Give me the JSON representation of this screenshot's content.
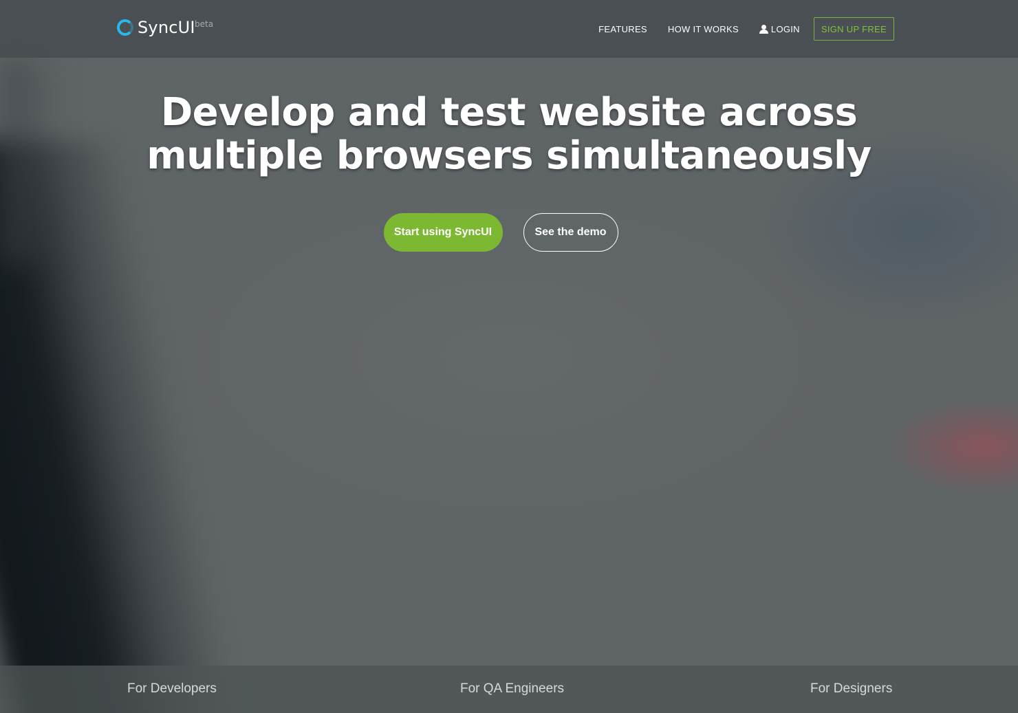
{
  "brand": {
    "name": "SyncUI",
    "badge": "beta",
    "logo_icon": "ring-logo-icon",
    "accent_color": "#29b6e8"
  },
  "nav": {
    "items": [
      {
        "label": "FEATURES"
      },
      {
        "label": "HOW IT WORKS"
      },
      {
        "label": "LOGIN",
        "icon": "user-icon"
      }
    ],
    "signup_label": "SIGN UP FREE",
    "signup_color": "#85c043"
  },
  "hero": {
    "title_line1": "Develop and test website across",
    "title_line2": "multiple browsers simultaneously",
    "primary_cta": "Start using SyncUI",
    "primary_color": "#7cb832",
    "secondary_cta": "See the demo"
  },
  "audiences": [
    {
      "label": "For Developers"
    },
    {
      "label": "For QA Engineers"
    },
    {
      "label": "For Designers"
    }
  ]
}
